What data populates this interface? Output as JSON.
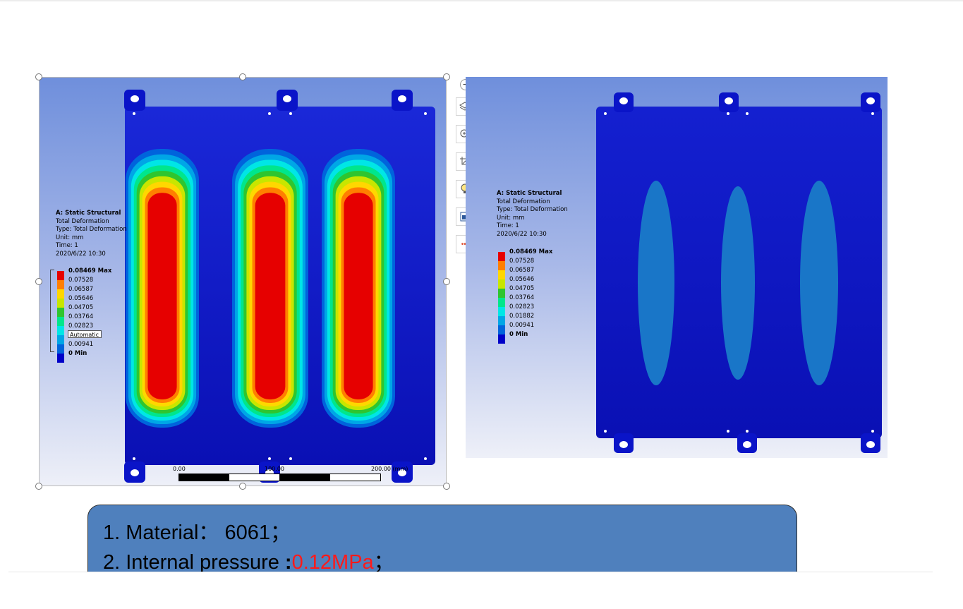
{
  "legend": {
    "title": "A: Static Structural",
    "lines": [
      "Total Deformation",
      "Type: Total Deformation",
      "Unit: mm",
      "Time: 1",
      "2020/6/22 10:30"
    ],
    "scale": [
      {
        "label": "0.08469 Max",
        "color": "#e60000"
      },
      {
        "label": "0.07528",
        "color": "#ff7f00"
      },
      {
        "label": "0.06587",
        "color": "#ffd700"
      },
      {
        "label": "0.05646",
        "color": "#c8e600"
      },
      {
        "label": "0.04705",
        "color": "#2fc52f"
      },
      {
        "label": "0.03764",
        "color": "#00e68c"
      },
      {
        "label": "0.02823",
        "color": "#00e6e6"
      },
      {
        "label": "0.01882",
        "color": "#00a6e6"
      },
      {
        "label": "0.00941",
        "color": "#0064dc"
      },
      {
        "label": "0 Min",
        "color": "#0000c8"
      }
    ],
    "automatic_label": "Automatic"
  },
  "ruler": {
    "start": "0.00",
    "mid": "100.00",
    "end": "200.00 (mm)"
  },
  "toolbar": [
    "minus-icon",
    "layers-icon",
    "zoom-in-icon",
    "crop-icon",
    "lightbulb-icon",
    "word-icon",
    "more-icon"
  ],
  "notes": {
    "line1_prefix": "1. Material",
    "line1_sep": "：",
    "line1_value": "6061",
    "line1_end": "；",
    "line2_prefix": "2. Internal pressure ",
    "line2_sep": ":",
    "line2_value": "0.12MPa",
    "line2_end": "；"
  },
  "colors": {
    "plate_blue": "#0a14c8",
    "bg_top": "#6f8fdc",
    "notes_box": "#4f80bd",
    "pressure_red": "#ff1a1a"
  }
}
